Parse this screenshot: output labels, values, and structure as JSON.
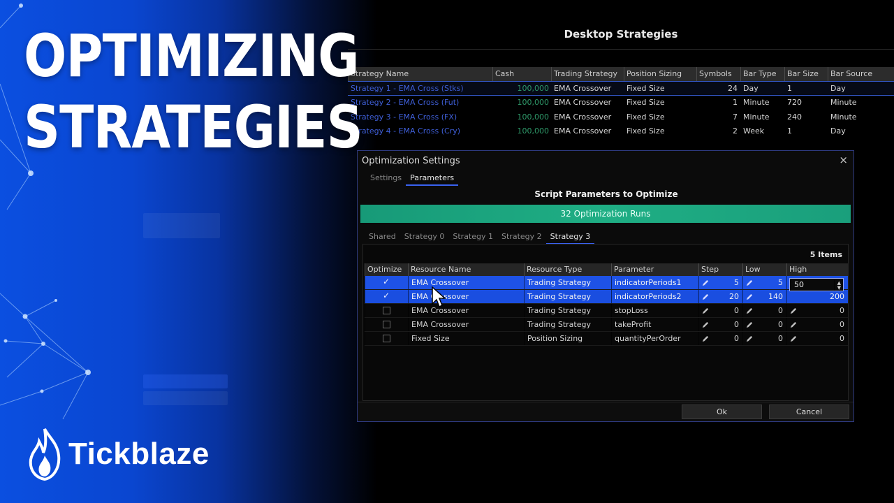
{
  "banner": {
    "headline_line1": "OPTIMIZING",
    "headline_line2": "STRATEGIES",
    "brand": "Tickblaze",
    "colors": {
      "blue": "#0b4fe0",
      "accent_green": "#1fae84",
      "selection_blue": "#1a4ee0"
    }
  },
  "desktop": {
    "title": "Desktop Strategies",
    "columns": [
      "Strategy Name",
      "Cash",
      "Trading Strategy",
      "Position Sizing",
      "Symbols",
      "Bar Type",
      "Bar Size",
      "Bar Source"
    ],
    "rows": [
      {
        "name": "Strategy 1 - EMA Cross (Stks)",
        "cash": "100,000",
        "trading": "EMA Crossover",
        "sizing": "Fixed Size",
        "symbols": "24",
        "bar_type": "Day",
        "bar_size": "1",
        "bar_source": "Day"
      },
      {
        "name": "Strategy 2 - EMA Cross (Fut)",
        "cash": "100,000",
        "trading": "EMA Crossover",
        "sizing": "Fixed Size",
        "symbols": "1",
        "bar_type": "Minute",
        "bar_size": "720",
        "bar_source": "Minute"
      },
      {
        "name": "Strategy 3 - EMA Cross (FX)",
        "cash": "100,000",
        "trading": "EMA Crossover",
        "sizing": "Fixed Size",
        "symbols": "7",
        "bar_type": "Minute",
        "bar_size": "240",
        "bar_source": "Minute"
      },
      {
        "name": "Strategy 4 - EMA Cross (Cry)",
        "cash": "100,000",
        "trading": "EMA Crossover",
        "sizing": "Fixed Size",
        "symbols": "2",
        "bar_type": "Week",
        "bar_size": "1",
        "bar_source": "Day"
      }
    ]
  },
  "dialog": {
    "title": "Optimization Settings",
    "close_glyph": "×",
    "tabs": [
      "Settings",
      "Parameters"
    ],
    "active_tab": "Parameters",
    "heading": "Script Parameters to Optimize",
    "runs_label": "32 Optimization Runs",
    "strategy_tabs": [
      "Shared",
      "Strategy 0",
      "Strategy 1",
      "Strategy 2",
      "Strategy 3"
    ],
    "active_strategy_tab": "Strategy 3",
    "items_count": "5 Items",
    "columns": [
      "Optimize",
      "Resource Name",
      "Resource Type",
      "Parameter",
      "Step",
      "Low",
      "High"
    ],
    "rows": [
      {
        "optimize": true,
        "resource": "EMA Crossover",
        "type": "Trading Strategy",
        "parameter": "indicatorPeriods1",
        "step": "5",
        "low": "5",
        "high": "50"
      },
      {
        "optimize": true,
        "resource": "EMA Crossover",
        "type": "Trading Strategy",
        "parameter": "indicatorPeriods2",
        "step": "20",
        "low": "140",
        "high": "200"
      },
      {
        "optimize": false,
        "resource": "EMA Crossover",
        "type": "Trading Strategy",
        "parameter": "stopLoss",
        "step": "0",
        "low": "0",
        "high": "0"
      },
      {
        "optimize": false,
        "resource": "EMA Crossover",
        "type": "Trading Strategy",
        "parameter": "takeProfit",
        "step": "0",
        "low": "0",
        "high": "0"
      },
      {
        "optimize": false,
        "resource": "Fixed Size",
        "type": "Position Sizing",
        "parameter": "quantityPerOrder",
        "step": "0",
        "low": "0",
        "high": "0"
      }
    ],
    "editing_value": "50",
    "ok_label": "Ok",
    "cancel_label": "Cancel"
  },
  "icons": [
    "flame-logo-icon",
    "pencil-icon",
    "checkbox-icon",
    "close-icon",
    "spinner-arrows-icon",
    "mouse-cursor-icon"
  ]
}
